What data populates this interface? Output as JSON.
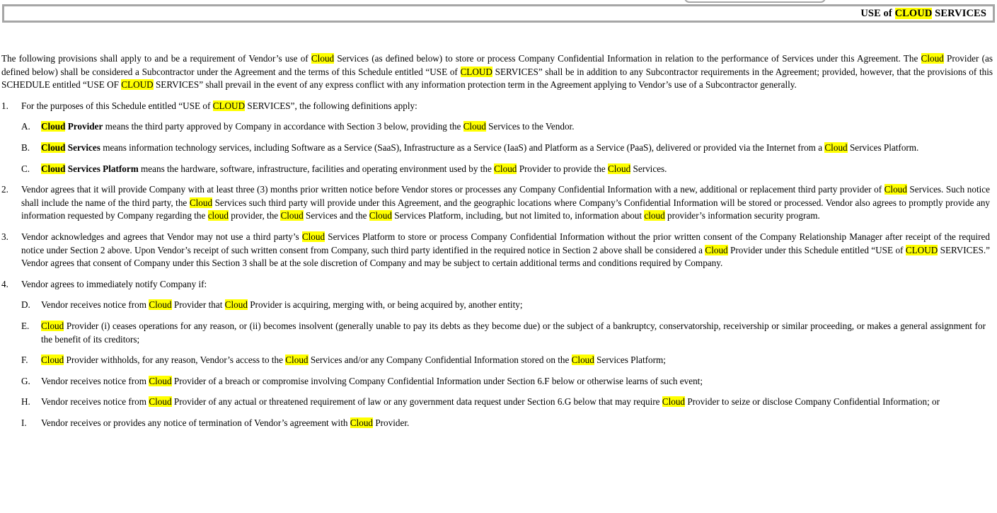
{
  "header": {
    "title_prefix": "USE of ",
    "title_highlight": "CLOUD",
    "title_suffix": " SERVICES",
    "highlight_color": "#ffff00",
    "border_color": "#a6a6a6"
  },
  "document": {
    "intro": {
      "s1": "The following provisions shall apply to and be a requirement of Vendor’s use of ",
      "h1": "Cloud",
      "s2": " Services (as defined below) to store or process Company Confidential Information in relation to the performance of Services under this Agreement. The ",
      "h2": "Cloud",
      "s3": " Provider (as defined below) shall be considered a Subcontractor under the Agreement and the terms of this Schedule entitled “USE of ",
      "h3": "CLOUD",
      "s4": " SERVICES” shall be in addition to any Subcontractor requirements in the Agreement; provided, however, that the provisions of this SCHEDULE entitled “USE OF ",
      "h4": "CLOUD",
      "s5": " SERVICES” shall prevail in the event of any express conflict with any information protection term in the Agreement applying to Vendor’s use of a Subcontractor generally."
    },
    "items": [
      {
        "marker": "1.",
        "s1": "For the purposes of this Schedule entitled “USE of ",
        "h1": "CLOUD",
        "s2": " SERVICES”, the following definitions apply:",
        "subitems": [
          {
            "marker": "A.",
            "bold_highlight": "Cloud",
            "bold_rest": " Provider",
            "s1": " means the third party approved by Company in accordance with Section 3 below, providing the ",
            "h1": "Cloud",
            "s2": " Services to the Vendor."
          },
          {
            "marker": "B.",
            "bold_highlight": "Cloud",
            "bold_rest": " Services",
            "s1": " means information technology services, including Software as a Service (SaaS), Infrastructure as a Service (IaaS) and Platform as a Service (PaaS), delivered or provided via the Internet from a ",
            "h1": "Cloud",
            "s2": " Services Platform."
          },
          {
            "marker": "C.",
            "bold_highlight": "Cloud",
            "bold_rest": " Services Platform",
            "s1": " means the hardware, software, infrastructure, facilities and operating environment used by the ",
            "h1": "Cloud",
            "s2": " Provider to provide the ",
            "h2": "Cloud",
            "s3": " Services."
          }
        ]
      },
      {
        "marker": "2.",
        "s1": "Vendor agrees that it will provide Company with at least three (3) months prior written notice before Vendor stores or processes any Company Confidential Information with a new, additional or replacement third party provider of ",
        "h1": "Cloud",
        "s2": " Services. Such notice shall include the name of the third party, the ",
        "h2": "Cloud",
        "s3": " Services such third party will provide under this Agreement, and the geographic locations where Company’s Confidential Information will be stored or processed. Vendor also agrees to promptly provide any information requested by Company regarding the ",
        "h3": "cloud",
        "s4": " provider, the ",
        "h4": "Cloud",
        "s5": " Services and the ",
        "h5": "Cloud",
        "s6": " Services Platform, including, but not limited to, information about ",
        "h6": "cloud",
        "s7": " provider’s information security program."
      },
      {
        "marker": "3.",
        "s1": "Vendor acknowledges and agrees that Vendor may not use a third party’s ",
        "h1": "Cloud",
        "s2": " Services Platform to store or process Company Confidential Information without the prior written consent of the Company Relationship Manager after receipt of the required notice under Section 2 above. Upon Vendor’s receipt of such written consent from Company, such third party identified in the required notice in Section 2 above shall be considered a ",
        "h2": "Cloud",
        "s3": " Provider under this Schedule entitled “USE of ",
        "h3": "CLOUD",
        "s4": " SERVICES.” Vendor agrees that consent of Company under this Section 3 shall be at the sole discretion of Company and may be subject to certain additional terms and conditions required by Company."
      },
      {
        "marker": "4.",
        "s1": "Vendor agrees to immediately notify Company if:",
        "subitems": [
          {
            "marker": "D.",
            "s1": "Vendor receives notice from ",
            "h1": "Cloud",
            "s2": " Provider that ",
            "h2": "Cloud",
            "s3": " Provider is acquiring, merging with, or being acquired by, another entity;"
          },
          {
            "marker": "E.",
            "h1": "Cloud",
            "s2": " Provider (i) ceases operations for any reason, or (ii) becomes insolvent (generally unable to pay its debts as they become due) or the subject of a bankruptcy, conservatorship, receivership or similar proceeding, or makes a general assignment for the benefit of its creditors;"
          },
          {
            "marker": "F.",
            "h1": "Cloud",
            "s2": " Provider withholds, for any reason, Vendor’s access to the ",
            "h2": "Cloud",
            "s3": " Services and/or any Company Confidential Information stored on the ",
            "h3": "Cloud",
            "s4": " Services Platform;"
          },
          {
            "marker": "G.",
            "s1": "Vendor receives notice from ",
            "h1": "Cloud",
            "s2": " Provider of a breach or compromise involving Company Confidential Information under Section 6.F below or otherwise learns of such event;"
          },
          {
            "marker": "H.",
            "s1": "Vendor receives notice from ",
            "h1": "Cloud",
            "s2": " Provider of any actual or threatened requirement of law or any government data request under Section 6.G below that may require ",
            "h2": "Cloud",
            "s3": " Provider to seize or disclose Company Confidential Information; or"
          },
          {
            "marker": "I.",
            "s1": "Vendor receives or provides any notice of termination of Vendor’s agreement with ",
            "h1": "Cloud",
            "s2": " Provider."
          }
        ]
      }
    ]
  }
}
